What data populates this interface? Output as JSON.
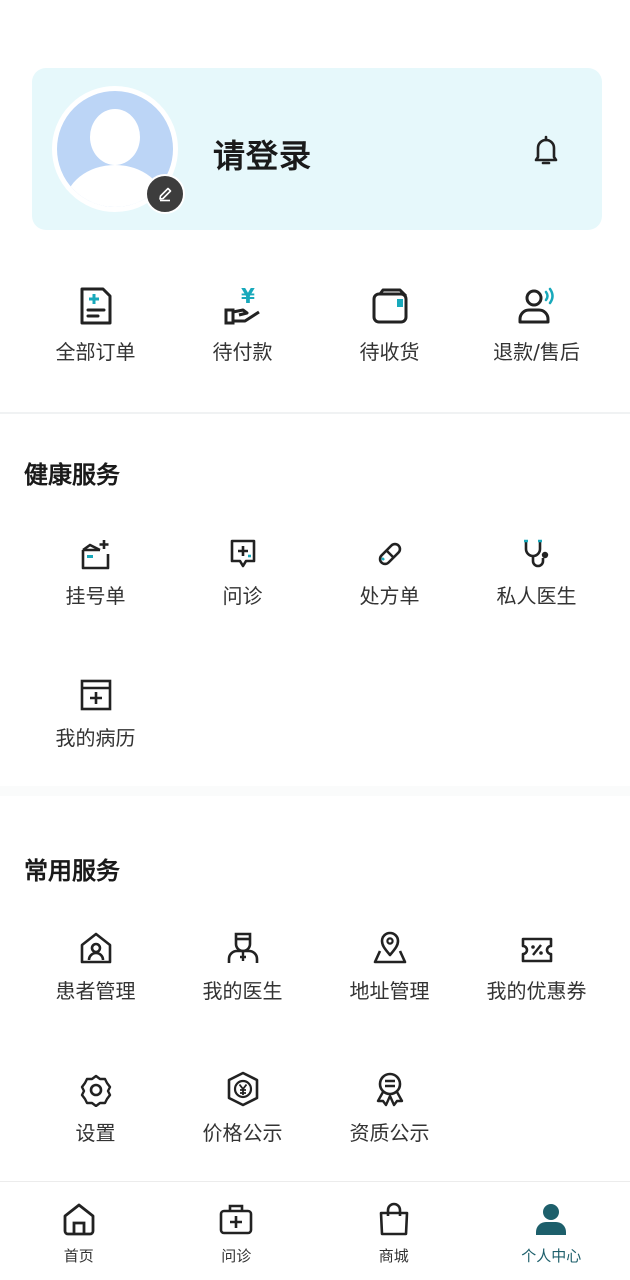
{
  "profile": {
    "login_text": "请登录"
  },
  "orders": [
    {
      "label": "全部订单",
      "icon": "document-icon"
    },
    {
      "label": "待付款",
      "icon": "payment-hand-icon"
    },
    {
      "label": "待收货",
      "icon": "package-icon"
    },
    {
      "label": "退款/售后",
      "icon": "customer-service-icon"
    }
  ],
  "health": {
    "title": "健康服务",
    "items": [
      {
        "label": "挂号单",
        "icon": "registration-icon"
      },
      {
        "label": "问诊",
        "icon": "consultation-icon"
      },
      {
        "label": "处方单",
        "icon": "pill-icon"
      },
      {
        "label": "私人医生",
        "icon": "stethoscope-icon"
      },
      {
        "label": "我的病历",
        "icon": "medical-record-icon"
      }
    ]
  },
  "common": {
    "title": "常用服务",
    "items": [
      {
        "label": "患者管理",
        "icon": "patient-home-icon"
      },
      {
        "label": "我的医生",
        "icon": "doctor-icon"
      },
      {
        "label": "地址管理",
        "icon": "location-icon"
      },
      {
        "label": "我的优惠券",
        "icon": "coupon-icon"
      },
      {
        "label": "设置",
        "icon": "gear-icon"
      },
      {
        "label": "价格公示",
        "icon": "price-yen-icon"
      },
      {
        "label": "资质公示",
        "icon": "certificate-icon"
      }
    ]
  },
  "tabbar": {
    "active_index": 3,
    "active_color": "#1d5f6b",
    "items": [
      {
        "label": "首页",
        "icon": "home-icon"
      },
      {
        "label": "问诊",
        "icon": "medical-kit-icon"
      },
      {
        "label": "商城",
        "icon": "shopping-bag-icon"
      },
      {
        "label": "个人中心",
        "icon": "person-icon"
      }
    ]
  },
  "colors": {
    "card_bg": "#e6f8fb",
    "accent_teal": "#18a9bb",
    "avatar_bg": "#bcd5f6"
  }
}
